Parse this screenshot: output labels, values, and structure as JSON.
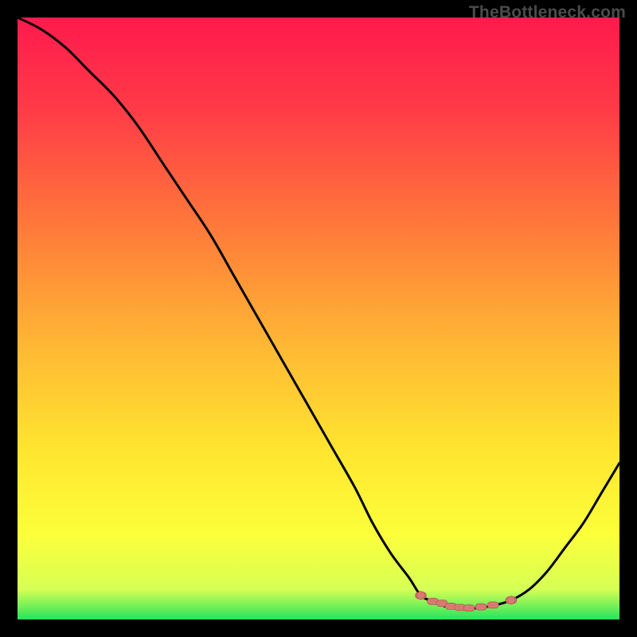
{
  "watermark": "TheBottleneck.com",
  "colors": {
    "curve": "#000000",
    "marker_fill": "#d97a72",
    "marker_stroke": "#b05a53"
  },
  "chart_data": {
    "type": "line",
    "title": "",
    "xlabel": "",
    "ylabel": "",
    "xlim": [
      0,
      100
    ],
    "ylim": [
      0,
      100
    ],
    "grid": false,
    "legend": false,
    "series": [
      {
        "name": "bottleneck-curve",
        "x": [
          0,
          4,
          8,
          12,
          16,
          20,
          24,
          28,
          32,
          36,
          40,
          44,
          48,
          52,
          56,
          59,
          62,
          65,
          67,
          69,
          71,
          73,
          75,
          77,
          79,
          82,
          85,
          88,
          91,
          94,
          97,
          100
        ],
        "values": [
          100,
          98,
          95,
          91,
          87,
          82,
          76,
          70,
          64,
          57,
          50,
          43,
          36,
          29,
          22,
          16,
          11,
          7,
          4,
          3,
          2.2,
          2,
          1.8,
          2,
          2.3,
          3.2,
          5,
          8,
          12,
          16,
          21,
          26
        ]
      }
    ],
    "markers": {
      "name": "highlighted-points",
      "x": [
        67,
        69,
        70.5,
        72,
        73.5,
        75,
        77,
        79,
        82
      ],
      "values": [
        4,
        3,
        2.7,
        2.2,
        2.0,
        1.9,
        2.1,
        2.4,
        3.2
      ]
    }
  }
}
